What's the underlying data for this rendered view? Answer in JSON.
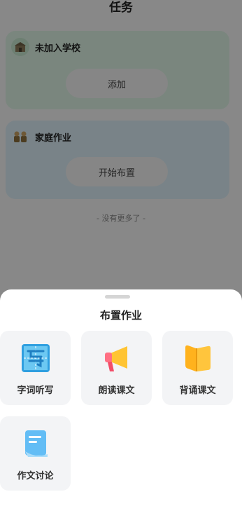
{
  "page": {
    "title": "任务",
    "no_more": "- 没有更多了 -"
  },
  "cards": {
    "school": {
      "title": "未加入学校",
      "button": "添加",
      "icon": "school-icon"
    },
    "family": {
      "title": "家庭作业",
      "button": "开始布置",
      "icon": "family-icon"
    }
  },
  "sheet": {
    "title": "布置作业",
    "items": [
      {
        "label": "字词听写",
        "icon": "dictation-icon"
      },
      {
        "label": "朗读课文",
        "icon": "megaphone-icon"
      },
      {
        "label": "背诵课文",
        "icon": "book-icon"
      },
      {
        "label": "作文讨论",
        "icon": "document-icon"
      }
    ]
  },
  "colors": {
    "school_card": "#dff5e6",
    "family_card": "#dceff7",
    "tile_bg": "#f3f4f6"
  }
}
